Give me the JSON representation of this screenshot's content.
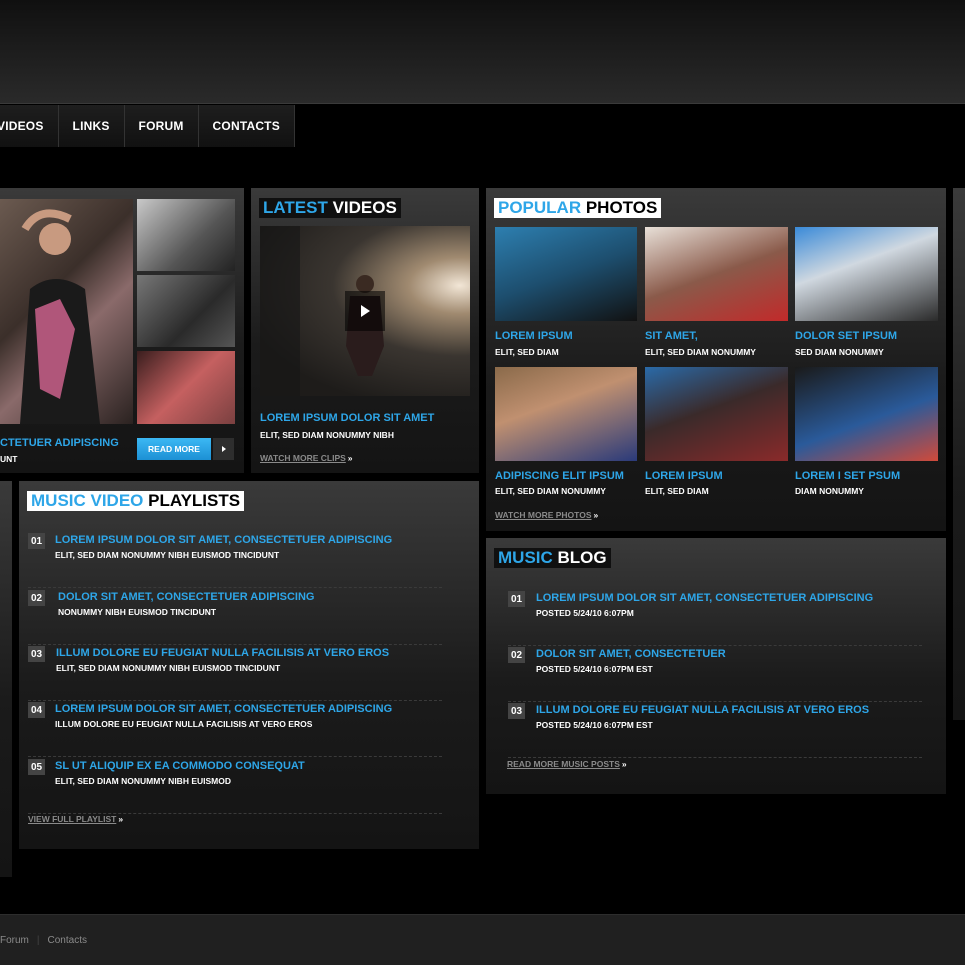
{
  "nav": {
    "items": [
      "VIDEOS",
      "LINKS",
      "FORUM",
      "CONTACTS"
    ]
  },
  "featured": {
    "title": "CTETUER ADIPISCING",
    "subtitle": "UNT",
    "read_more": "READ MORE"
  },
  "latest_videos": {
    "heading_accent": "LATEST",
    "heading_rest": " VIDEOS",
    "title": "LOREM IPSUM DOLOR SIT AMET",
    "subtitle": "ELIT, SED DIAM NONUMMY NIBH",
    "more_link": "WATCH MORE CLIPS"
  },
  "popular_photos": {
    "heading_accent": "POPULAR",
    "heading_rest": " PHOTOS",
    "items": [
      {
        "title": "LOREM IPSUM",
        "subtitle": "ELIT, SED DIAM"
      },
      {
        "title": "SIT AMET,",
        "subtitle": "ELIT, SED DIAM NONUMMY"
      },
      {
        "title": "DOLOR SET IPSUM",
        "subtitle": "SED DIAM NONUMMY"
      },
      {
        "title": "ADIPISCING ELIT IPSUM",
        "subtitle": "ELIT, SED DIAM NONUMMY"
      },
      {
        "title": "LOREM IPSUM",
        "subtitle": "ELIT, SED DIAM"
      },
      {
        "title": "LOREM I SET PSUM",
        "subtitle": "DIAM NONUMMY"
      }
    ],
    "more_link": "WATCH MORE PHOTOS"
  },
  "playlists": {
    "heading_accent": "MUSIC VIDEO",
    "heading_rest": " PLAYLISTS",
    "items": [
      {
        "num": "01",
        "title": "LOREM IPSUM DOLOR SIT AMET, CONSECTETUER ADIPISCING",
        "subtitle": "ELIT, SED DIAM NONUMMY NIBH EUISMOD TINCIDUNT"
      },
      {
        "num": "02",
        "title": "DOLOR SIT AMET, CONSECTETUER ADIPISCING",
        "subtitle": "NONUMMY NIBH EUISMOD TINCIDUNT"
      },
      {
        "num": "03",
        "title": "ILLUM DOLORE EU FEUGIAT NULLA FACILISIS AT VERO EROS",
        "subtitle": "ELIT, SED DIAM NONUMMY NIBH EUISMOD TINCIDUNT"
      },
      {
        "num": "04",
        "title": "LOREM IPSUM DOLOR SIT AMET, CONSECTETUER ADIPISCING",
        "subtitle": "ILLUM DOLORE EU FEUGIAT NULLA FACILISIS AT VERO EROS"
      },
      {
        "num": "05",
        "title": "SL UT ALIQUIP EX EA COMMODO CONSEQUAT",
        "subtitle": "ELIT, SED DIAM NONUMMY NIBH EUISMOD"
      }
    ],
    "more_link": "VIEW FULL PLAYLIST"
  },
  "blog": {
    "heading_accent": "MUSIC",
    "heading_rest": " BLOG",
    "items": [
      {
        "num": "01",
        "title": "LOREM IPSUM DOLOR SIT AMET, CONSECTETUER ADIPISCING",
        "subtitle": "POSTED 5/24/10 6:07PM"
      },
      {
        "num": "02",
        "title": "DOLOR SIT AMET, CONSECTETUER",
        "subtitle": "POSTED 5/24/10 6:07PM EST"
      },
      {
        "num": "03",
        "title": "ILLUM DOLORE EU FEUGIAT NULLA FACILISIS AT VERO EROS",
        "subtitle": "POSTED 5/24/10 6:07PM EST"
      }
    ],
    "more_link": "READ MORE MUSIC POSTS"
  },
  "footer": {
    "links": [
      "Forum",
      "Contacts"
    ]
  },
  "colors": {
    "accent": "#2ea6e8",
    "background": "#000000",
    "panel": "#2a2a2a"
  }
}
